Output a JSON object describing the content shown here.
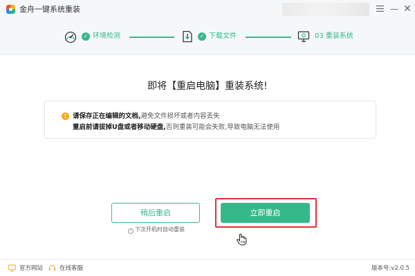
{
  "window": {
    "title": "金舟一键系统重装",
    "menu_icon": "hamburger-menu-icon",
    "minimize_symbol": "—",
    "close_symbol": "✕"
  },
  "steps": [
    {
      "icon": "speedometer-icon",
      "label": "环境检测",
      "status": "done"
    },
    {
      "icon": "download-file-icon",
      "label": "下载文件",
      "status": "done"
    },
    {
      "icon": "monitor-icon",
      "label": "03 重装系统",
      "status": "current"
    }
  ],
  "check_symbol": "✓",
  "heading": "即将【重启电脑】重装系统!",
  "warning": {
    "icon_symbol": "!",
    "line1_bold": "请保存正在编辑的文档,",
    "line1_rest": "避免文件损坏或者内容丢失",
    "line2_bold": "重启前请拔掉U盘或者移动硬盘,",
    "line2_rest": "否则重装可能会失败,导致电脑无法使用"
  },
  "buttons": {
    "later_label": "稍后重启",
    "now_label": "立即重启"
  },
  "hint": {
    "icon_symbol": "!",
    "text": "下次开机时自动重装"
  },
  "footer": {
    "website_label": "官方网站",
    "support_label": "在线客服",
    "version": "版本号:v2.0.5"
  },
  "colors": {
    "accent": "#36b98a",
    "highlight_frame": "#e03030",
    "warning": "#f5a623"
  }
}
